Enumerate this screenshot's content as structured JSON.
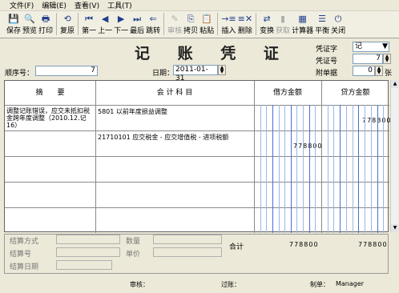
{
  "menu": [
    "文件(F)",
    "编辑(E)",
    "查看(V)",
    "工具(T)"
  ],
  "toolbar": [
    {
      "label": "保存",
      "icon": "save-icon",
      "glyph": "💾",
      "enabled": true
    },
    {
      "label": "预览",
      "icon": "preview-icon",
      "glyph": "🔍",
      "enabled": true
    },
    {
      "label": "打印",
      "icon": "print-icon",
      "glyph": "🖶",
      "enabled": true
    },
    {
      "label": "复原",
      "icon": "restore-icon",
      "glyph": "⟲",
      "enabled": true
    },
    {
      "label": "第一",
      "icon": "first-icon",
      "glyph": "⏮",
      "enabled": true
    },
    {
      "label": "上一",
      "icon": "prev-icon",
      "glyph": "◀",
      "enabled": true
    },
    {
      "label": "下一",
      "icon": "next-icon",
      "glyph": "▶",
      "enabled": true
    },
    {
      "label": "最后",
      "icon": "last-icon",
      "glyph": "⏭",
      "enabled": true
    },
    {
      "label": "跳转",
      "icon": "jump-icon",
      "glyph": "⇐",
      "enabled": true
    },
    {
      "label": "审核",
      "icon": "audit-icon",
      "glyph": "✎",
      "enabled": false
    },
    {
      "label": "拷贝",
      "icon": "copy-icon",
      "glyph": "⎘",
      "enabled": true
    },
    {
      "label": "粘贴",
      "icon": "paste-icon",
      "glyph": "📋",
      "enabled": true
    },
    {
      "label": "插入",
      "icon": "insert-icon",
      "glyph": "→≡",
      "enabled": true
    },
    {
      "label": "删除",
      "icon": "delete-icon",
      "glyph": "≡✕",
      "enabled": true
    },
    {
      "label": "变换",
      "icon": "transform-icon",
      "glyph": "⇄",
      "enabled": true
    },
    {
      "label": "获取",
      "icon": "fetch-icon",
      "glyph": "▮",
      "enabled": false
    },
    {
      "label": "计算器",
      "icon": "calculator-icon",
      "glyph": "▦",
      "enabled": true
    },
    {
      "label": "平衡",
      "icon": "balance-icon",
      "glyph": "☰",
      "enabled": true
    },
    {
      "label": "关闭",
      "icon": "close-icon",
      "glyph": "⏻",
      "enabled": true
    }
  ],
  "title": "记 账 凭 证",
  "seq_label": "顺序号：",
  "seq_value": "7",
  "date_label": "日期：",
  "date_value": "2011-01-31",
  "voucher_type_label": "凭证字",
  "voucher_type_value": "记",
  "voucher_no_label": "凭证号",
  "voucher_no_value": "7",
  "attach_label": "附单据",
  "attach_value": "0",
  "attach_unit": "张",
  "headers": {
    "summary": "摘　　要",
    "account": "会 计 科 目",
    "debit": "借方金额",
    "credit": "贷方金额"
  },
  "rows": [
    {
      "summary": "调整记账错误，应交未抵扣税金跨年度调整（2010.12.记16）",
      "account": "5801 以前年度损益调整",
      "debit": "",
      "credit": "778800"
    },
    {
      "summary": "",
      "account": "21710101 应交税金 - 应交增值税 - 进项税额",
      "debit": "778800",
      "credit": ""
    }
  ],
  "total_label": "合计",
  "total_debit": "778800",
  "total_credit": "778800",
  "bottom": {
    "settle_method": "结算方式",
    "settle_no": "结算号",
    "settle_date": "结算日期",
    "quantity": "数量",
    "unit_price": "单价"
  },
  "status": {
    "audit_label": "审核：",
    "post_label": "过账：",
    "maker_label": "制单：",
    "maker_value": "Manager"
  }
}
